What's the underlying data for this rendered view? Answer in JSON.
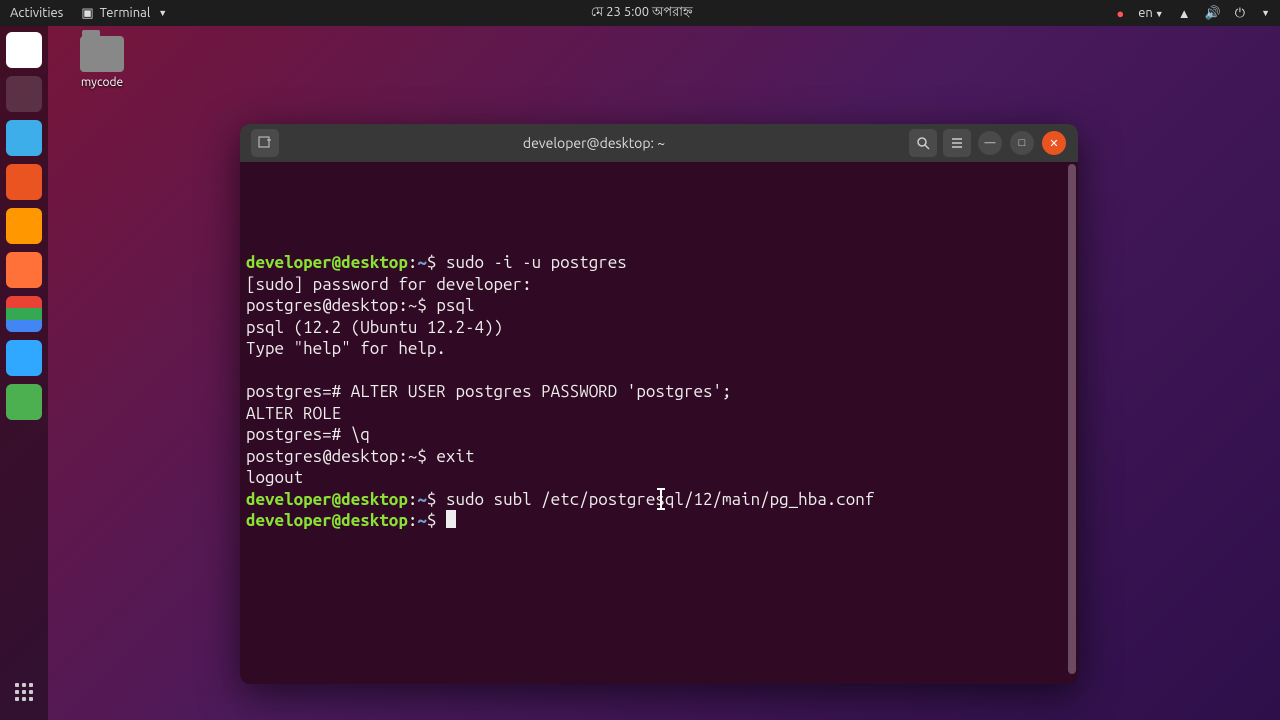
{
  "topbar": {
    "activities": "Activities",
    "app_name": "Terminal",
    "datetime": "মে 23  5:00 অপরাহ্ন",
    "lang": "en"
  },
  "desktop": {
    "folder_label": "mycode"
  },
  "terminal": {
    "title": "developer@desktop: ~",
    "lines": [
      {
        "type": "prompt_dev",
        "user": "developer@desktop",
        "path": "~",
        "cmd": "sudo -i -u postgres"
      },
      {
        "type": "plain",
        "text": "[sudo] password for developer: "
      },
      {
        "type": "prompt_pg",
        "user": "postgres@desktop",
        "path": "~",
        "cmd": "psql"
      },
      {
        "type": "plain",
        "text": "psql (12.2 (Ubuntu 12.2-4))"
      },
      {
        "type": "plain",
        "text": "Type \"help\" for help."
      },
      {
        "type": "plain",
        "text": ""
      },
      {
        "type": "plain",
        "text": "postgres=# ALTER USER postgres PASSWORD 'postgres';"
      },
      {
        "type": "plain",
        "text": "ALTER ROLE"
      },
      {
        "type": "plain",
        "text": "postgres=# \\q"
      },
      {
        "type": "prompt_pg",
        "user": "postgres@desktop",
        "path": "~",
        "cmd": "exit"
      },
      {
        "type": "plain",
        "text": "logout"
      },
      {
        "type": "prompt_dev",
        "user": "developer@desktop",
        "path": "~",
        "cmd": "sudo subl /etc/postgresql/12/main/pg_hba.conf"
      },
      {
        "type": "prompt_dev",
        "user": "developer@desktop",
        "path": "~",
        "cmd": "",
        "cursor": true
      }
    ]
  },
  "dock": {
    "items": [
      "files",
      "terminal",
      "gedit",
      "software",
      "sublime",
      "firefox",
      "chrome",
      "phpstorm",
      "geo"
    ]
  }
}
